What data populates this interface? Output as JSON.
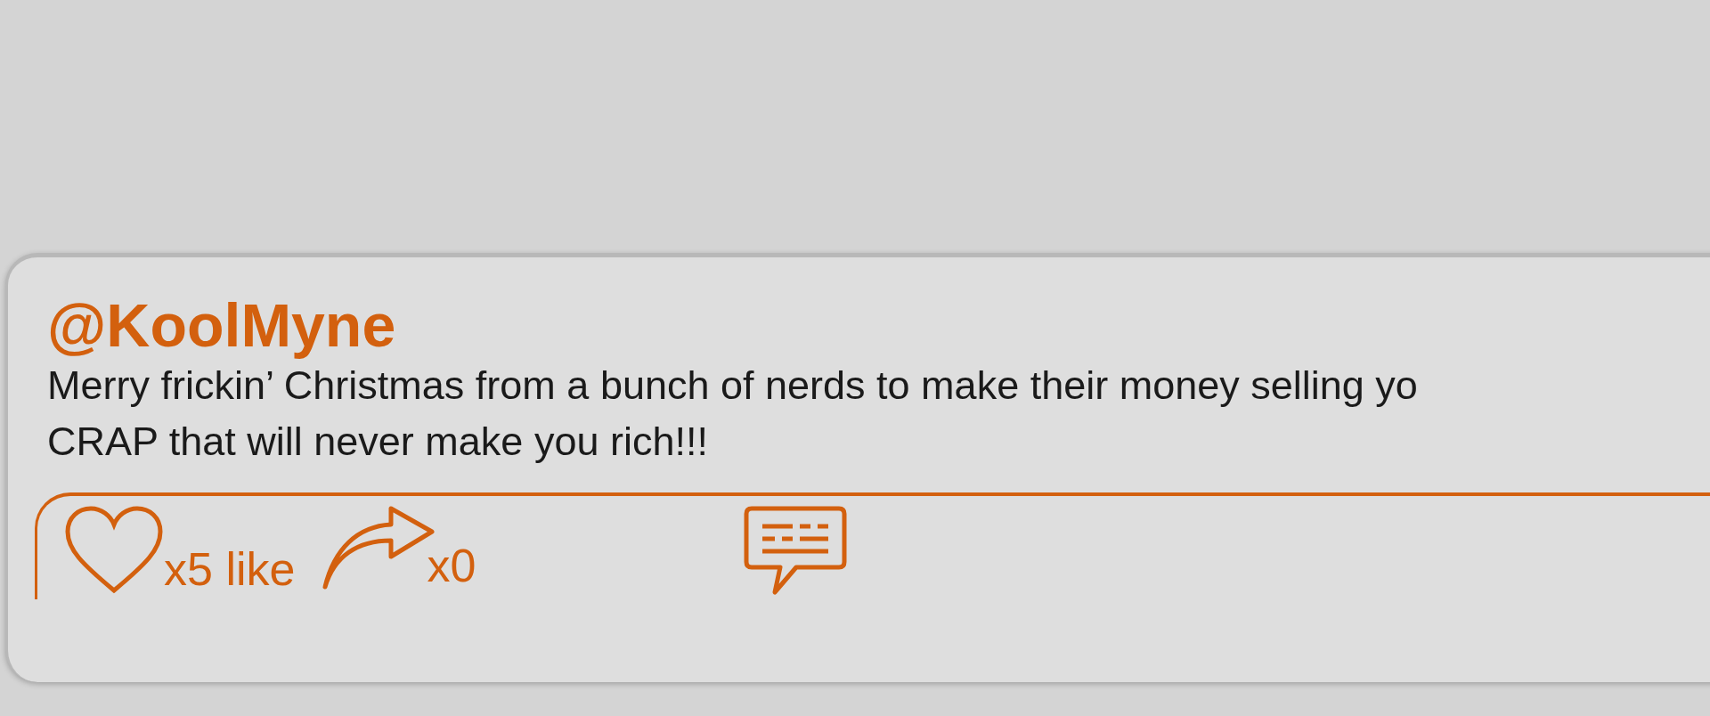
{
  "post": {
    "username": "@KoolMyne",
    "body_lines": [
      "Merry frickin’ Christmas from a bunch of nerds to make their money selling yo",
      "CRAP that will never make you rich!!!"
    ],
    "likes": {
      "count": "x5",
      "label": "like"
    },
    "shares": {
      "count": "x0"
    }
  }
}
